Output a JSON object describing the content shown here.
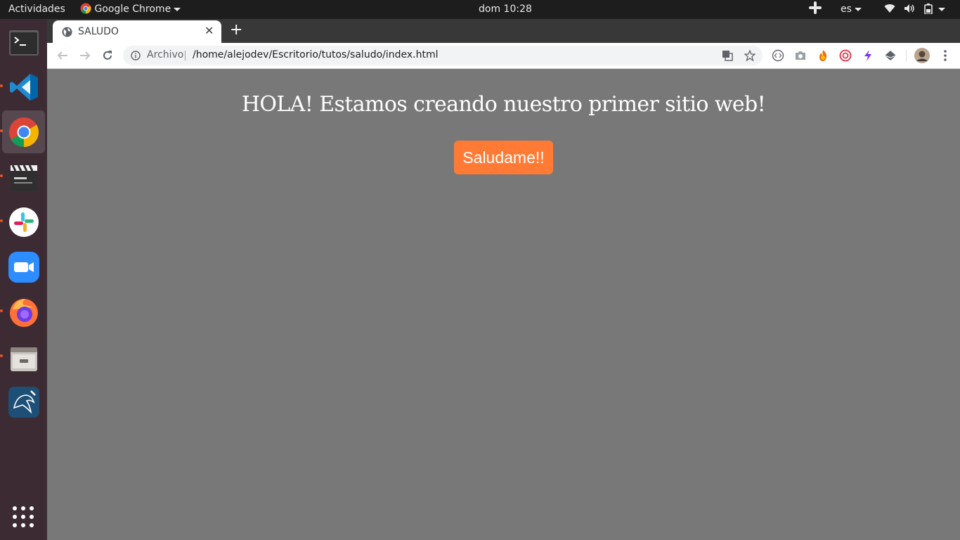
{
  "system": {
    "activities_label": "Actividades",
    "app_menu_label": "Google Chrome",
    "clock": "dom 10:28",
    "keyboard_layout": "es"
  },
  "dock": {
    "items": [
      {
        "name": "terminal",
        "icon": "terminal-icon",
        "running": false
      },
      {
        "name": "vscode",
        "icon": "vscode-icon",
        "running": true
      },
      {
        "name": "chrome",
        "icon": "chrome-icon",
        "running": true,
        "active": true
      },
      {
        "name": "video-editor",
        "icon": "clapperboard-icon",
        "running": true
      },
      {
        "name": "slack",
        "icon": "slack-icon",
        "running": true
      },
      {
        "name": "zoom",
        "icon": "zoom-icon",
        "running": false
      },
      {
        "name": "firefox",
        "icon": "firefox-icon",
        "running": true
      },
      {
        "name": "files",
        "icon": "file-cabinet-icon",
        "running": true
      },
      {
        "name": "mysql-workbench",
        "icon": "dolphin-icon",
        "running": false
      }
    ]
  },
  "browser": {
    "tab": {
      "title": "SALUDO"
    },
    "omnibox": {
      "security_label": "Archivo",
      "url": "/home/alejodev/Escritorio/tutos/saludo/index.html"
    }
  },
  "page": {
    "heading": "HOLA! Estamos creando nuestro primer sitio web!",
    "button_label": "Saludame!!",
    "background_color": "#787878",
    "button_color": "#ff7b35"
  }
}
